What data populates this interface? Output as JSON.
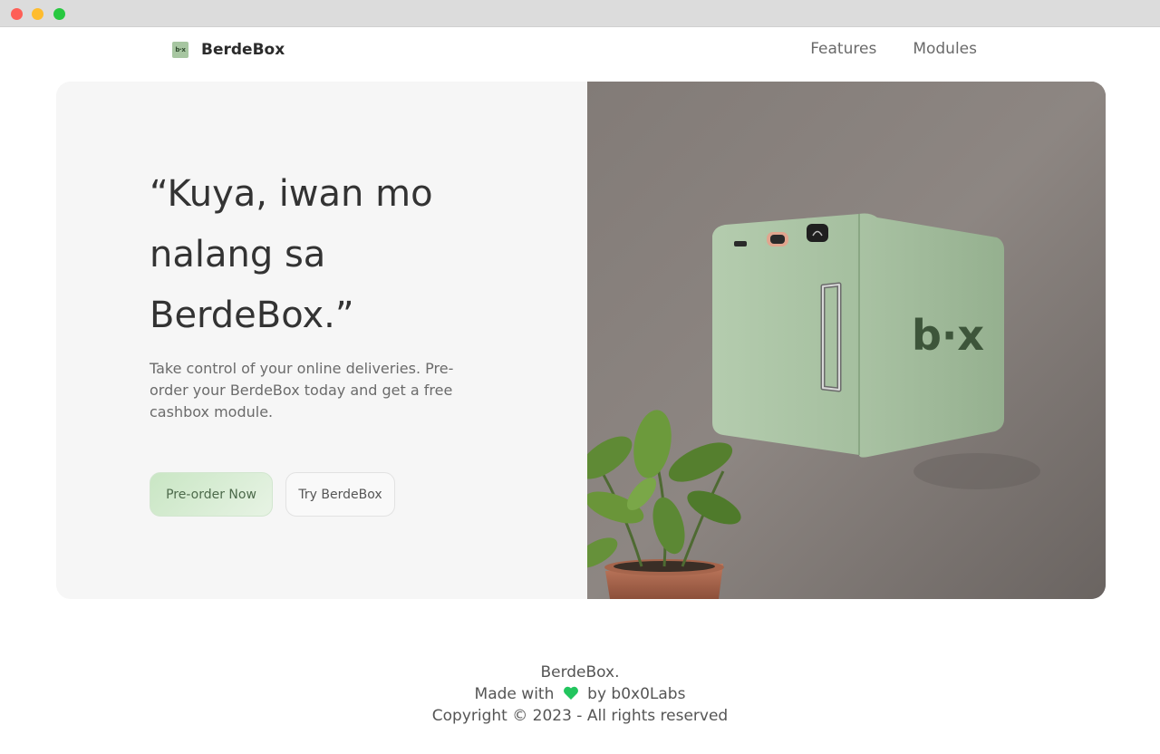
{
  "window": {
    "controls": [
      "close",
      "minimize",
      "maximize"
    ]
  },
  "nav": {
    "brand_logo_text": "b·x",
    "brand_name": "BerdeBox",
    "links": [
      "Features",
      "Modules"
    ]
  },
  "hero": {
    "headline": "“Kuya, iwan mo nalang sa BerdeBox.”",
    "subtext": "Take control of your online deliveries. Pre-order your BerdeBox today and get a free cashbox module.",
    "primary_button": "Pre-order Now",
    "secondary_button": "Try BerdeBox",
    "product_logo_text": "b·x"
  },
  "footer": {
    "brand": "BerdeBox.",
    "made_with": "Made with",
    "made_by": "by b0x0Labs",
    "copyright": "Copyright © 2023 - All rights reserved"
  },
  "colors": {
    "accent_green": "#a7c6a1",
    "heart": "#22c55e"
  }
}
